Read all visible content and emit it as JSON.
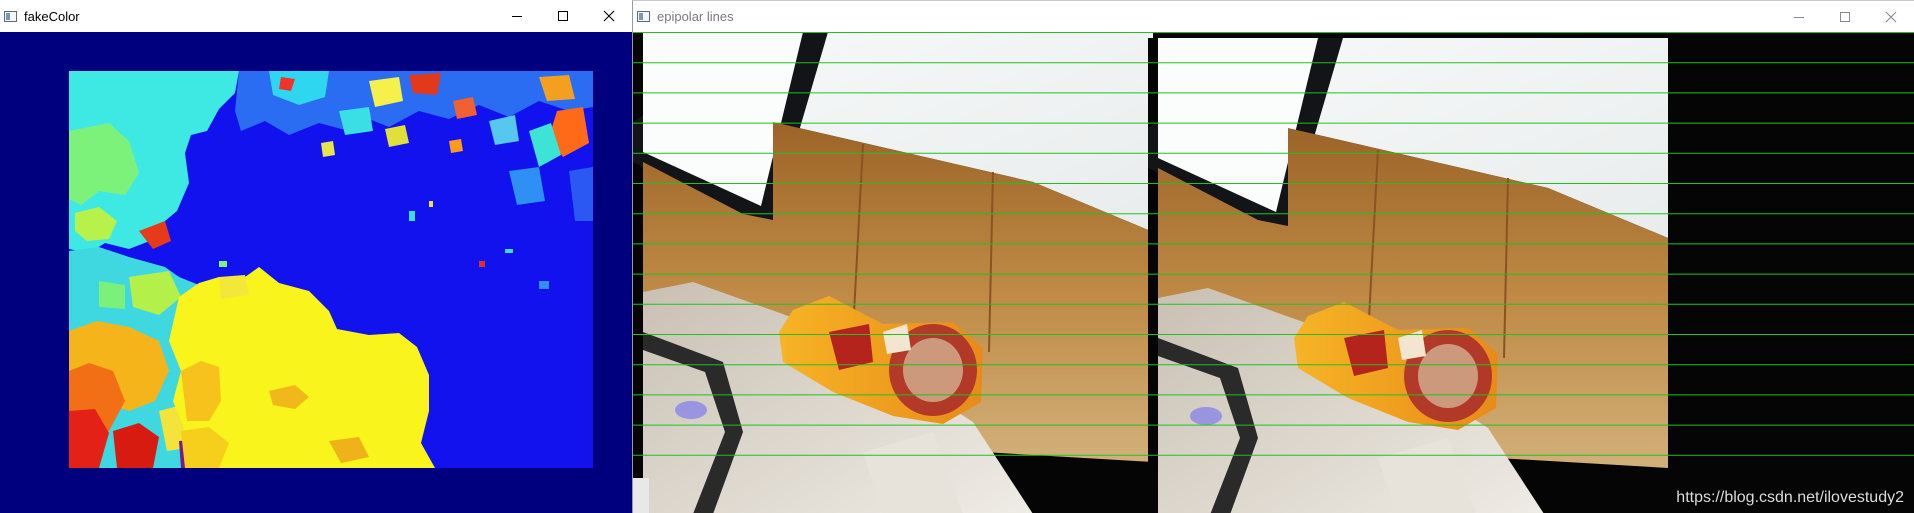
{
  "windows": {
    "fake_color": {
      "title": "fakeColor",
      "background": "#00007f",
      "icon": "opencv-window-icon",
      "controls": [
        "minimize-icon",
        "maximize-icon",
        "close-icon"
      ]
    },
    "epipolar": {
      "title": "epipolar lines",
      "icon": "opencv-window-icon",
      "line_color": "#22c022",
      "line_count": 15,
      "controls": [
        "minimize-icon",
        "maximize-icon",
        "close-icon"
      ],
      "watermark": "https://blog.csdn.net/ilovestudy2"
    }
  },
  "colors": {
    "depth_background": "#1010ee",
    "depth_near": "#ffff00",
    "depth_far": "#0000a0",
    "wall": "#f4f6f6",
    "cabinet": "#b07a38",
    "table": "#ded8cc",
    "bottle": "#f0a21e"
  }
}
